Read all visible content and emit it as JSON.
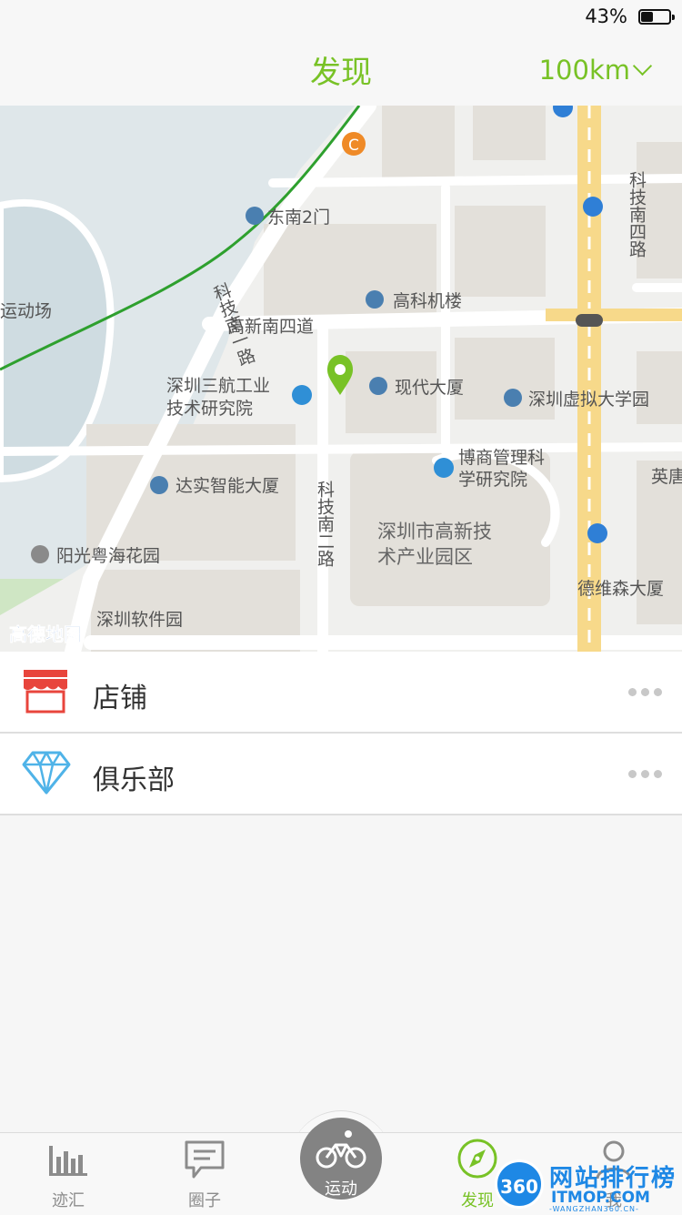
{
  "status_bar": {
    "battery_text": "43%",
    "battery_level": 0.43
  },
  "nav": {
    "title": "发现",
    "range": "100km"
  },
  "map": {
    "labels": [
      "东南2门",
      "科技南四路",
      "高科机楼",
      "高新南四道",
      "科技南一路",
      "深圳三航工业",
      "技术研究院",
      "现代大厦",
      "深圳虚拟大学园",
      "达实智能大厦",
      "博商管理科",
      "学研究院",
      "英唐",
      "科技南二路",
      "深圳市高新技",
      "术产业园区",
      "阳光粤海花园",
      "德维森大厦",
      "深圳软件园",
      "运动场"
    ],
    "logo": "高德地图"
  },
  "list": [
    {
      "label": "店铺",
      "icon": "store-icon"
    },
    {
      "label": "俱乐部",
      "icon": "diamond-icon"
    }
  ],
  "tabs": [
    {
      "label": "迹汇",
      "icon": "bar-chart-icon"
    },
    {
      "label": "圈子",
      "icon": "chat-bubble-icon"
    },
    {
      "label": "运动",
      "icon": "bicycle-icon"
    },
    {
      "label": "发现",
      "icon": "compass-icon"
    },
    {
      "label": "我",
      "icon": "user-icon"
    }
  ],
  "watermark": {
    "badge": "360",
    "title": "网站排行榜",
    "domain": "ITMOP.COM",
    "sub": "-WANGZHAN360.CN-"
  },
  "colors": {
    "accent": "#78c226",
    "store": "#e8453c",
    "club": "#4fb3e8",
    "map_road_major": "#f7d98a"
  }
}
